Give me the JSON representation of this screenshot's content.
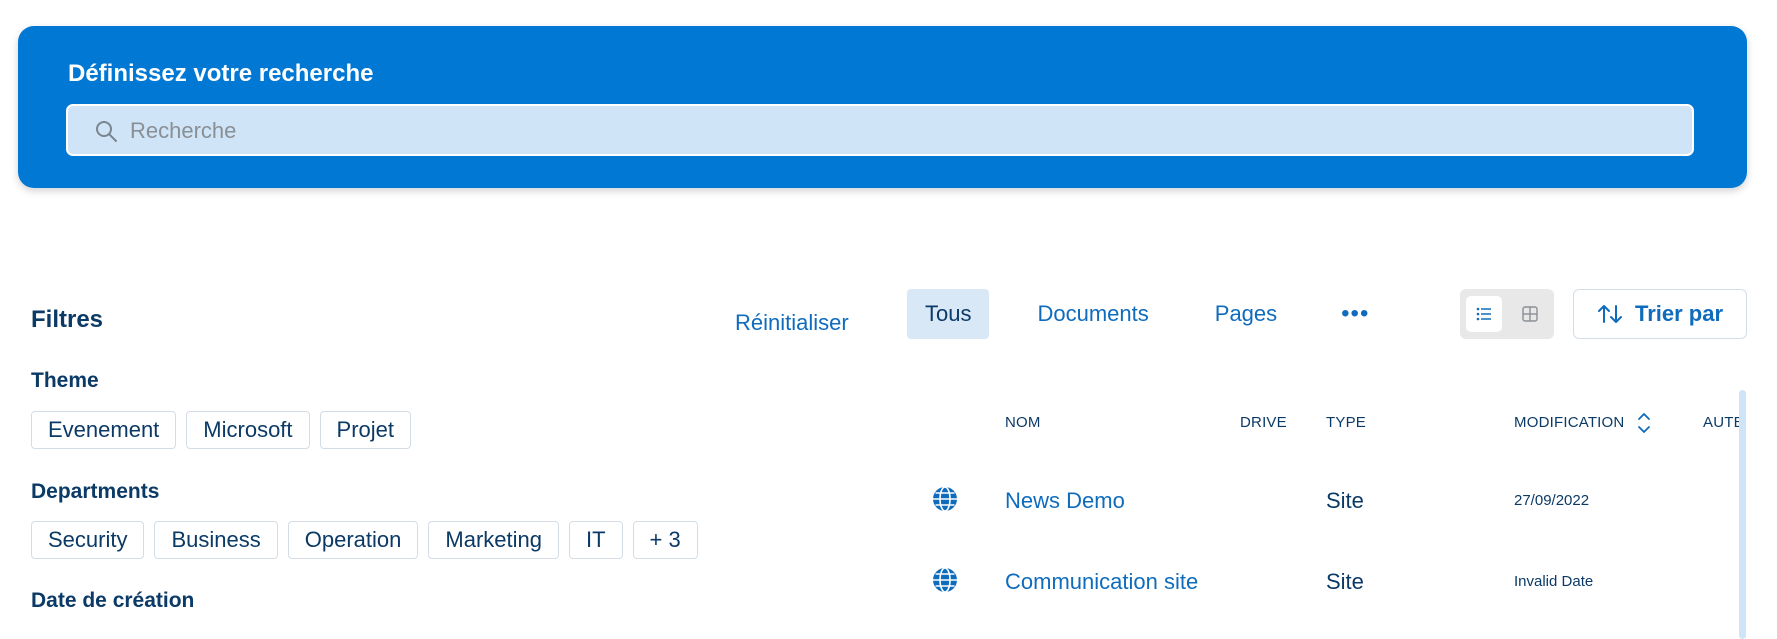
{
  "search": {
    "title": "Définissez votre recherche",
    "placeholder": "Recherche",
    "icon": "search-icon"
  },
  "filters": {
    "title": "Filtres",
    "reset_label": "Réinitialiser",
    "groups": [
      {
        "label": "Theme",
        "chips": [
          "Evenement",
          "Microsoft",
          "Projet"
        ]
      },
      {
        "label": "Departments",
        "chips": [
          "Security",
          "Business",
          "Operation",
          "Marketing",
          "IT",
          "+ 3"
        ]
      },
      {
        "label": "Date de création",
        "chips": []
      }
    ]
  },
  "tabs": [
    {
      "label": "Tous",
      "active": true
    },
    {
      "label": "Documents",
      "active": false
    },
    {
      "label": "Pages",
      "active": false
    }
  ],
  "more_label": "•••",
  "view_toggle": {
    "list_icon": "list-view-icon",
    "grid_icon": "grid-view-icon",
    "active": "list"
  },
  "sort_button": {
    "label": "Trier par",
    "icon": "sort-arrows-icon"
  },
  "table": {
    "columns": [
      "NOM",
      "DRIVE",
      "TYPE",
      "MODIFICATION",
      "AUTE"
    ],
    "rows": [
      {
        "icon": "globe-icon",
        "name": "News Demo",
        "drive": "",
        "type": "Site",
        "modified": "27/09/2022"
      },
      {
        "icon": "globe-icon",
        "name": "Communication site",
        "drive": "",
        "type": "Site",
        "modified": "Invalid Date"
      }
    ]
  },
  "colors": {
    "banner": "#0078d4",
    "search_bg": "#cfe4f6",
    "accent": "#0f6cbd",
    "text_dark": "#0b3a66",
    "active_tab_bg": "#d8e8f7"
  }
}
